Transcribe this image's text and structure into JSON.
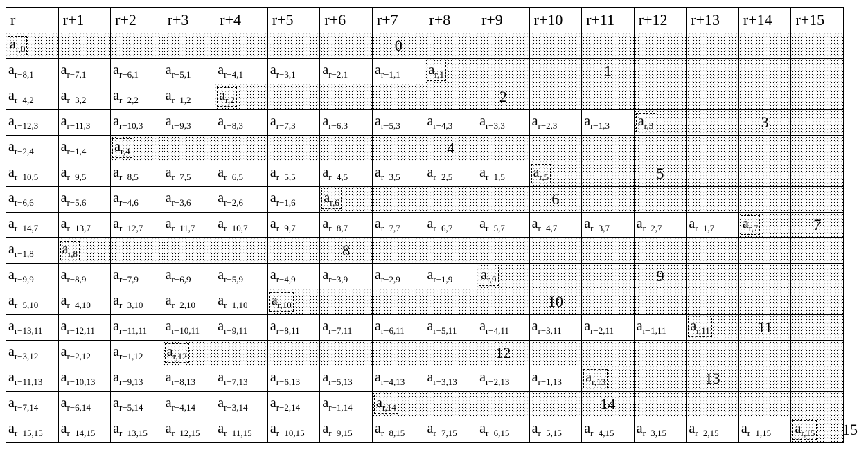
{
  "cols": 16,
  "rows": 16,
  "headers": [
    "r",
    "r+1",
    "r+2",
    "r+3",
    "r+4",
    "r+5",
    "r+6",
    "r+7",
    "r+8",
    "r+9",
    "r+10",
    "r+11",
    "r+12",
    "r+13",
    "r+14",
    "r+15"
  ],
  "row_defs": [
    {
      "j": 0,
      "pre": 0,
      "diag": 0,
      "num": 7
    },
    {
      "j": 1,
      "pre": 8,
      "diag": 8,
      "num": 11
    },
    {
      "j": 2,
      "pre": 4,
      "diag": 4,
      "num": 9
    },
    {
      "j": 3,
      "pre": 12,
      "diag": 12,
      "num": 14
    },
    {
      "j": 4,
      "pre": 2,
      "diag": 2,
      "num": 8
    },
    {
      "j": 5,
      "pre": 10,
      "diag": 10,
      "num": 12
    },
    {
      "j": 6,
      "pre": 6,
      "diag": 6,
      "num": 10
    },
    {
      "j": 7,
      "pre": 14,
      "diag": 14,
      "num": 15
    },
    {
      "j": 8,
      "pre": 1,
      "diag": 1,
      "num": 6
    },
    {
      "j": 9,
      "pre": 9,
      "diag": 9,
      "num": 12
    },
    {
      "j": 10,
      "pre": 5,
      "diag": 5,
      "num": 10
    },
    {
      "j": 11,
      "pre": 13,
      "diag": 13,
      "num": 14
    },
    {
      "j": 12,
      "pre": 3,
      "diag": 3,
      "num": 9
    },
    {
      "j": 13,
      "pre": 11,
      "diag": 11,
      "num": 13
    },
    {
      "j": 14,
      "pre": 7,
      "diag": 7,
      "num": 11
    },
    {
      "j": 15,
      "pre": 15,
      "diag": 15,
      "num": 16
    }
  ],
  "out_label": "15"
}
